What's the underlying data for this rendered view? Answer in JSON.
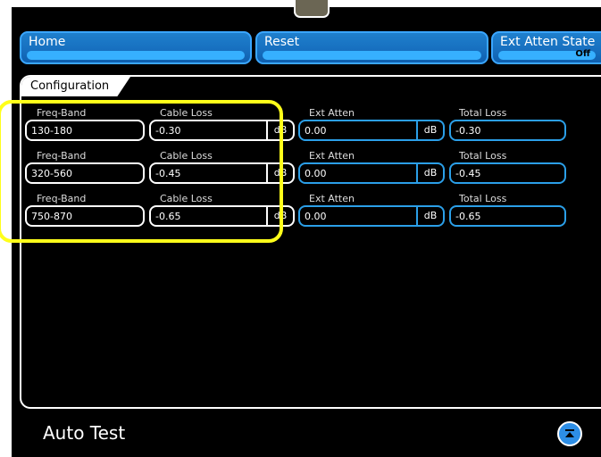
{
  "header": {
    "home_label": "Home",
    "reset_label": "Reset",
    "ext_atten_state_label": "Ext Atten State",
    "ext_atten_state_value": "Off"
  },
  "panel": {
    "tab_label": "Configuration"
  },
  "rows": [
    {
      "freq_band_caption": "Freq-Band",
      "freq_band": "130-180",
      "cable_loss_caption": "Cable Loss",
      "cable_loss": "-0.30",
      "cable_loss_unit": "dB",
      "ext_atten_caption": "Ext Atten",
      "ext_atten": "0.00",
      "ext_atten_unit": "dB",
      "total_loss_caption": "Total Loss",
      "total_loss": "-0.30"
    },
    {
      "freq_band_caption": "Freq-Band",
      "freq_band": "320-560",
      "cable_loss_caption": "Cable Loss",
      "cable_loss": "-0.45",
      "cable_loss_unit": "dB",
      "ext_atten_caption": "Ext Atten",
      "ext_atten": "0.00",
      "ext_atten_unit": "dB",
      "total_loss_caption": "Total Loss",
      "total_loss": "-0.45"
    },
    {
      "freq_band_caption": "Freq-Band",
      "freq_band": "750-870",
      "cable_loss_caption": "Cable Loss",
      "cable_loss": "-0.65",
      "cable_loss_unit": "dB",
      "ext_atten_caption": "Ext Atten",
      "ext_atten": "0.00",
      "ext_atten_unit": "dB",
      "total_loss_caption": "Total Loss",
      "total_loss": "-0.65"
    }
  ],
  "footer": {
    "title": "Auto Test",
    "scroll_icon": "scroll-to-top-icon"
  },
  "colors": {
    "accent": "#1770c0",
    "field_blue": "#2b9fe8",
    "highlight": "#ffff1a"
  }
}
